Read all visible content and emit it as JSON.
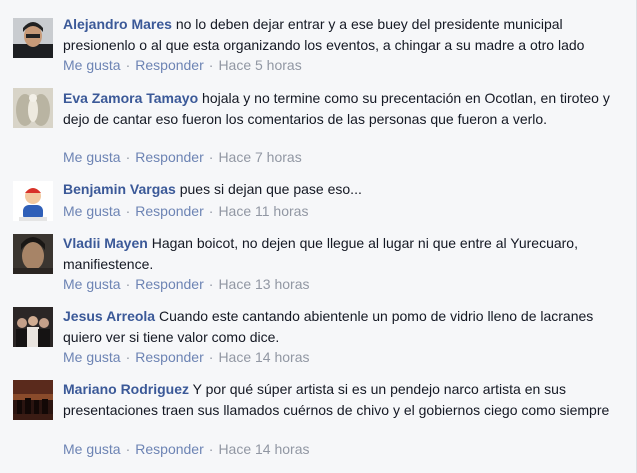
{
  "comments": [
    {
      "author": "Alejandro Mares",
      "text": "no lo deben dejar entrar y a ese buey del presidente municipal presionenlo o al que esta organizando los eventos, a chingar a su madre a otro lado",
      "like": "Me gusta",
      "reply": "Responder",
      "time": "Hace 5 horas",
      "avatar_icon": "user-photo-icon"
    },
    {
      "author": "Eva Zamora Tamayo",
      "text": "hojala y no termine como su precentación en Ocotlan, en tiroteo y dejo de cantar eso fueron los comentarios de las personas que fueron a verlo.",
      "like": "Me gusta",
      "reply": "Responder",
      "time": "Hace 7 horas",
      "avatar_icon": "angel-photo-icon"
    },
    {
      "author": "Benjamin Vargas",
      "text": "pues si dejan que pase eso...",
      "like": "Me gusta",
      "reply": "Responder",
      "time": "Hace 11 horas",
      "avatar_icon": "cartoon-avatar-icon"
    },
    {
      "author": "Vladii Mayen",
      "text": "Hagan boicot, no dejen que llegue al lugar ni que entre al Yurecuaro, manifiestence.",
      "like": "Me gusta",
      "reply": "Responder",
      "time": "Hace 13 horas",
      "avatar_icon": "user-photo-icon"
    },
    {
      "author": "Jesus Arreola",
      "text": "Cuando este cantando abientenle un pomo de vidrio lleno de lacranes quiero ver si tiene valor como dice.",
      "like": "Me gusta",
      "reply": "Responder",
      "time": "Hace 14 horas",
      "avatar_icon": "group-photo-icon"
    },
    {
      "author": "Mariano Rodriguez",
      "text": "Y por qué súper artista si es un pendejo narco artista en sus presentaciones traen sus llamados cuérnos de chivo y el gobiernos ciego como siempre",
      "like": "Me gusta",
      "reply": "Responder",
      "time": "Hace 14 horas",
      "avatar_icon": "movie-poster-icon"
    }
  ]
}
